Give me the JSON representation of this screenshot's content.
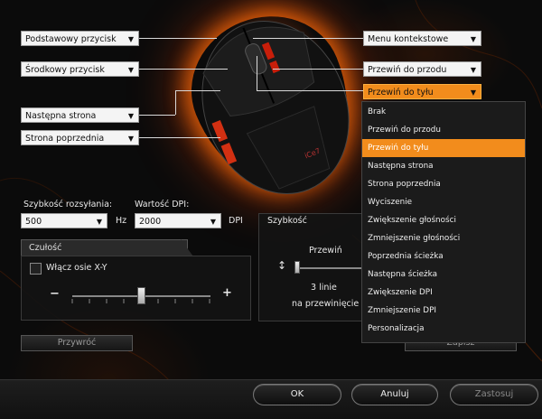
{
  "left_combos": [
    {
      "label": "Podstawowy przycisk"
    },
    {
      "label": "Środkowy przycisk"
    },
    {
      "label": "Następna strona"
    },
    {
      "label": "Strona poprzednia"
    }
  ],
  "right_combos": [
    {
      "label": "Menu kontekstowe"
    },
    {
      "label": "Przewiń do przodu"
    },
    {
      "label": "Przewiń do tyłu"
    }
  ],
  "arrow_glyph": "▼",
  "polling": {
    "label": "Szybkość rozsyłania:",
    "value": "500",
    "unit": "Hz"
  },
  "dpi": {
    "label": "Wartość DPI:",
    "value": "2000",
    "unit": "DPI"
  },
  "sensitivity": {
    "tab_label": "Czułość",
    "checkbox_label": "Włącz osie X-Y",
    "checked": false,
    "minus": "−",
    "plus": "+",
    "slider_level": 0.5
  },
  "speed": {
    "tab_label": "Szybkość",
    "scroll_title": "Przewiń",
    "scroll_value_line1": "3 linie",
    "scroll_value_line2": "na przewinięcie"
  },
  "restore_button": "Przywróć",
  "save_button": "Zapisz",
  "menu": {
    "items": [
      "Brak",
      "Przewiń do przodu",
      "Przewiń do tyłu",
      "Następna strona",
      "Strona poprzednia",
      "Wyciszenie",
      "Zwiększenie głośności",
      "Zmniejszenie głośności",
      "Poprzednia ścieżka",
      "Następna ścieżka",
      "Zwiększenie DPI",
      "Zmniejszenie DPI",
      "Personalizacja"
    ],
    "selected_index": 2
  },
  "footer": {
    "ok": "OK",
    "cancel": "Anuluj",
    "apply": "Zastosuj"
  },
  "colors": {
    "accent": "#f28c1c",
    "glow": "#ff6e0a"
  }
}
